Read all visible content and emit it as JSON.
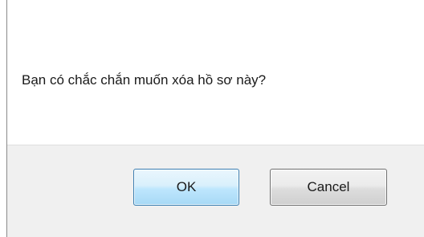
{
  "dialog": {
    "message": "Bạn có chắc chắn muốn xóa hồ sơ này?",
    "ok_label": "OK",
    "cancel_label": "Cancel"
  },
  "colors": {
    "button_area_bg": "#f0f0f0",
    "ok_border": "#3c7fb1",
    "cancel_border": "#707070"
  }
}
